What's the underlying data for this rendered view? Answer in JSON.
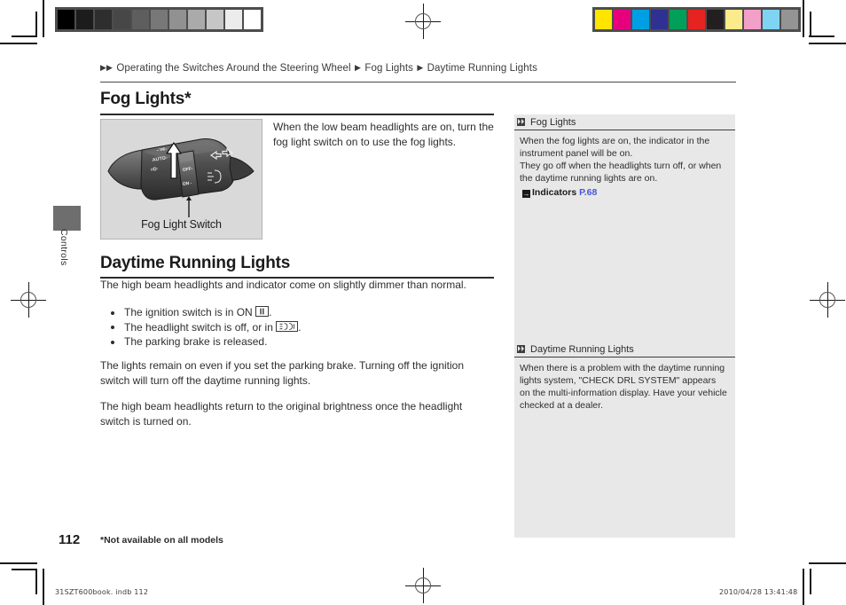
{
  "document": {
    "page_number": "112",
    "footnote": "*Not available on all models",
    "thumb_tab_label": "Controls"
  },
  "breadcrumb": {
    "arrow_glyph": "▶",
    "segments": [
      "Operating the Switches Around the Steering Wheel",
      "Fog Lights",
      "Daytime Running Lights"
    ]
  },
  "sections": [
    {
      "title": "Fog Lights*",
      "intro": "When the low beam headlights are on, turn the fog light switch on to use the fog lights.",
      "figure_caption": "Fog Light Switch",
      "figure_labels": {
        "auto": "AUTO",
        "off": "OFF",
        "on": "ON"
      }
    },
    {
      "title": "Daytime Running Lights",
      "lead": "The high beam headlights and indicator come on slightly dimmer than normal.",
      "bullets": [
        {
          "before": "The ignition switch is in ON ",
          "glyph": "ignition-position-II-icon",
          "after": "."
        },
        {
          "before": "The headlight switch is off, or in ",
          "glyph": "position-lamp-icon",
          "after": "."
        },
        {
          "before": "The parking brake is released.",
          "glyph": "",
          "after": ""
        }
      ],
      "paragraphs": [
        "The lights remain on even if you set the parking brake. Turning off the ignition switch will turn off the daytime running lights.",
        "The high beam headlights return to the original brightness once the headlight switch is turned on."
      ]
    }
  ],
  "sidebar": {
    "notes": [
      {
        "heading": "Fog Lights",
        "body": "When the fog lights are on, the indicator in the instrument panel will be on.\nThey go off when the headlights turn off, or when the daytime running lights are on.",
        "reference": {
          "icon_glyph": "→",
          "label": "Indicators",
          "page": "P.68"
        }
      },
      {
        "heading": "Daytime Running Lights",
        "body": "When there is a problem with the daytime running lights system, \"CHECK DRL SYSTEM\" appears on the multi-information display. Have your vehicle checked at a dealer.",
        "reference": null
      }
    ]
  },
  "prepress": {
    "file_name": "31SZT600book. indb    112",
    "timestamp": "2010/04/28    13:41:48",
    "grayscale_patches": [
      "#000000",
      "#1c1c1c",
      "#2e2e2e",
      "#474747",
      "#5e5e5e",
      "#787878",
      "#919191",
      "#aaaaaa",
      "#c6c6c6",
      "#ececec",
      "#ffffff"
    ],
    "color_patches": [
      "#ffe400",
      "#e6007e",
      "#009fe3",
      "#2e3192",
      "#00a05a",
      "#e52421",
      "#231f20",
      "#fbeb8a",
      "#f3a0c8",
      "#7fd4f4",
      "#949494"
    ]
  },
  "colors": {
    "link": "#4757d4",
    "sidebar_bg": "#e8e8e8",
    "rule": "#2b2b2b",
    "text": "#2e2e2e"
  }
}
